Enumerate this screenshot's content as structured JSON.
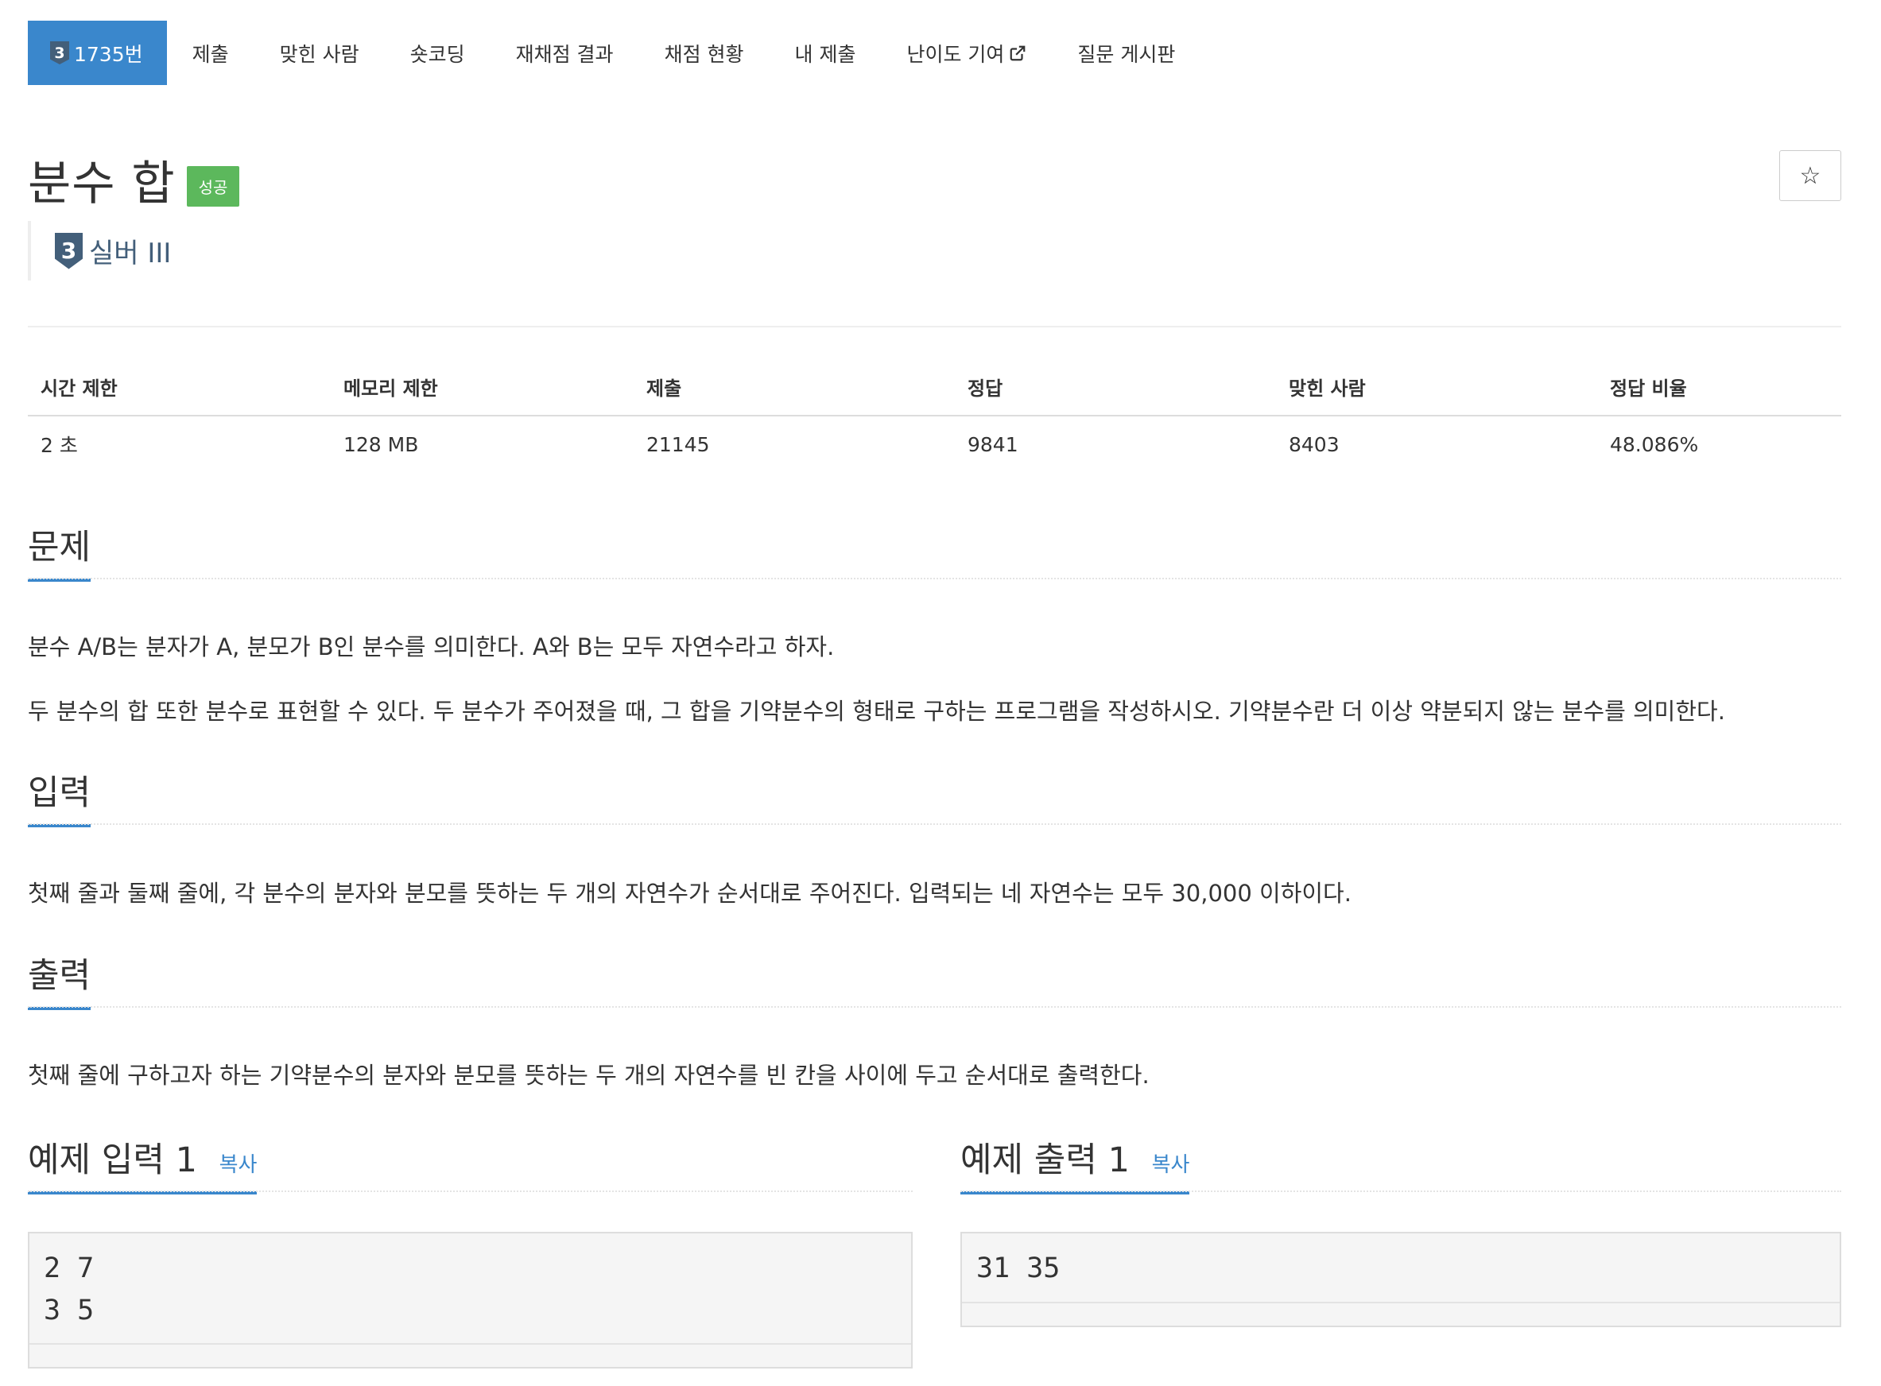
{
  "nav": {
    "problem_tier": "3",
    "problem_id": "1735번",
    "items": [
      "제출",
      "맞힌 사람",
      "숏코딩",
      "재채점 결과",
      "채점 현황",
      "내 제출",
      "난이도 기여",
      "질문 게시판"
    ]
  },
  "problem": {
    "title": "분수 합",
    "status_label": "성공",
    "star": "☆",
    "tier_number": "3",
    "tier_name": "실버 III"
  },
  "stats": {
    "headers": [
      "시간 제한",
      "메모리 제한",
      "제출",
      "정답",
      "맞힌 사람",
      "정답 비율"
    ],
    "values": [
      "2 초",
      "128 MB",
      "21145",
      "9841",
      "8403",
      "48.086%"
    ]
  },
  "sections": {
    "description_title": "문제",
    "description": [
      "분수 A/B는 분자가 A, 분모가 B인 분수를 의미한다. A와 B는 모두 자연수라고 하자.",
      "두 분수의 합 또한 분수로 표현할 수 있다. 두 분수가 주어졌을 때, 그 합을 기약분수의 형태로 구하는 프로그램을 작성하시오. 기약분수란 더 이상 약분되지 않는 분수를 의미한다."
    ],
    "input_title": "입력",
    "input": "첫째 줄과 둘째 줄에, 각 분수의 분자와 분모를 뜻하는 두 개의 자연수가 순서대로 주어진다. 입력되는 네 자연수는 모두 30,000 이하이다.",
    "output_title": "출력",
    "output": "첫째 줄에 구하고자 하는 기약분수의 분자와 분모를 뜻하는 두 개의 자연수를 빈 칸을 사이에 두고 순서대로 출력한다."
  },
  "samples": {
    "input_title": "예제 입력 1",
    "output_title": "예제 출력 1",
    "copy_label": "복사",
    "input_text": "2 7\n3 5",
    "output_text": "31 35"
  },
  "colors": {
    "accent": "#3a87cc",
    "success": "#5cb85c",
    "tier_silver": "#435f7a"
  }
}
